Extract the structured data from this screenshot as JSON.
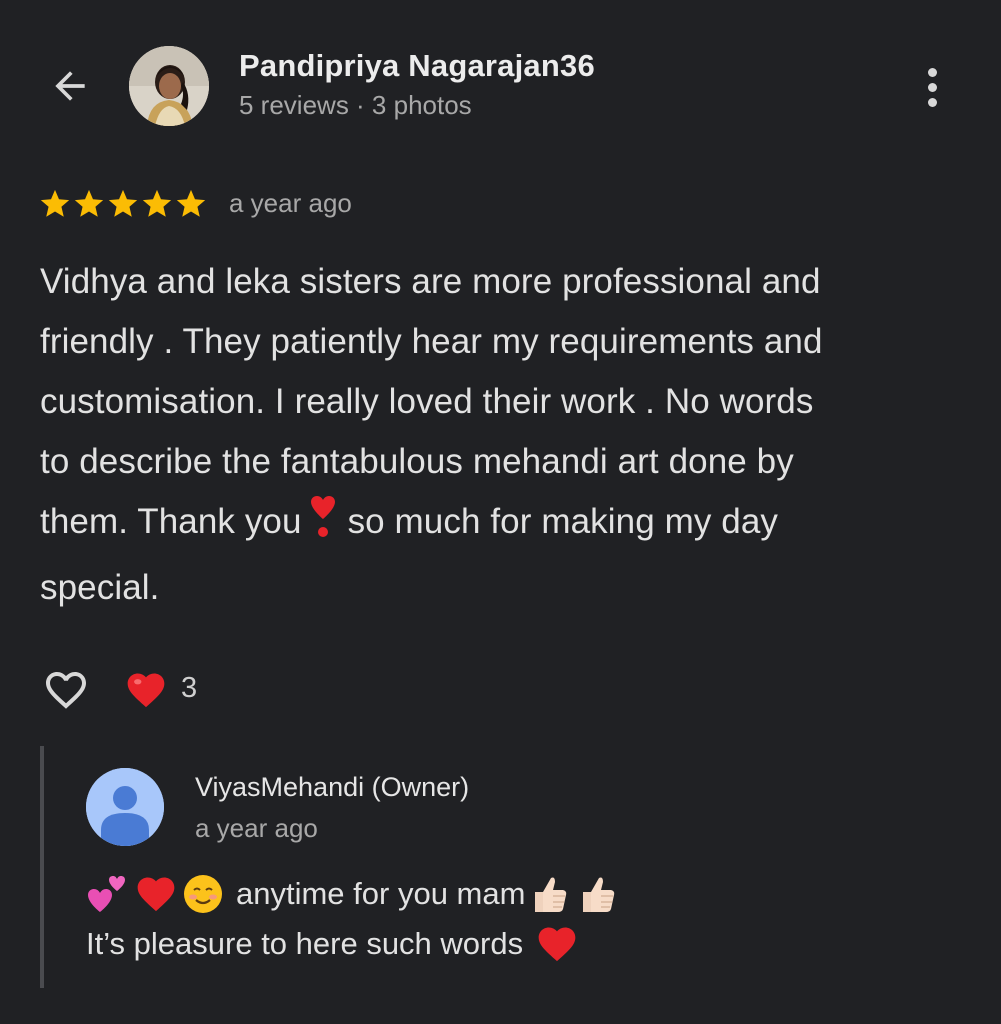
{
  "header": {
    "reviewer_name": "Pandipriya Nagarajan36",
    "reviewer_meta": "5 reviews · 3 photos",
    "back_icon": "arrow-left-icon",
    "more_icon": "more-vert-icon"
  },
  "review": {
    "rating": 5,
    "rating_max": 5,
    "time": "a year ago",
    "text_lines": [
      "Vidhya and leka sisters are more professional and",
      "friendly . They patiently hear my requirements and",
      "customisation. I really loved their work . No words",
      "to describe the fantabulous mehandi art done by",
      "them. Thank you",
      "so much for making my day",
      "special."
    ],
    "inline_emoji": "heavy-heart-exclamation"
  },
  "reactions": {
    "like_icon": "heart-outline-icon",
    "reaction_emoji": "red-heart",
    "count": "3"
  },
  "owner_reply": {
    "name": "ViyasMehandi (Owner)",
    "time": "a year ago",
    "line1_emojis": [
      "two-hearts",
      "red-heart",
      "smiling-face"
    ],
    "line1_text": "anytime for you mam",
    "line1_trailing_emojis": [
      "thumbs-up-light-skin",
      "thumbs-up-light-skin"
    ],
    "line2_text": "It’s pleasure to here such words",
    "line2_trailing_emoji": "red-heart"
  },
  "colors": {
    "background": "#202124",
    "star": "#fbbc04",
    "heart": "#e8232a",
    "owner_avatar": "#a8c7fa"
  }
}
